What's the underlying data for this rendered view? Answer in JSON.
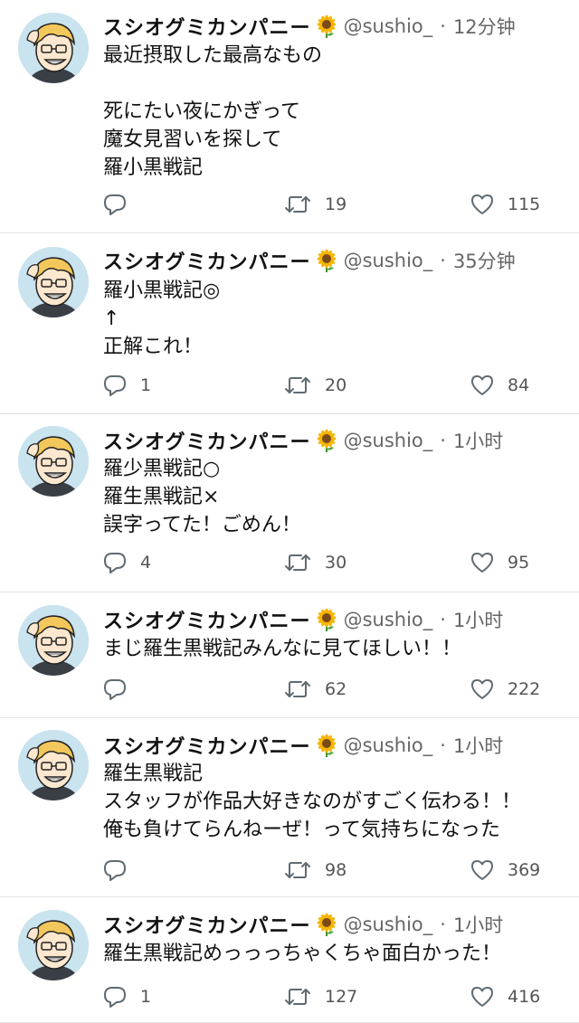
{
  "colors": {
    "text": "#111111",
    "muted": "#666666",
    "icon": "#5f6b73",
    "divider": "#e3e3e3",
    "avatar_bg": "#c9e3ef",
    "hair": "#f2c75b"
  },
  "tweets": [
    {
      "name": "スシオグミカンパニー",
      "emoji_icon": "sunflower-icon",
      "handle": "@sushio_",
      "dot": "·",
      "time": "12分钟",
      "lines": [
        "最近摂取した最高なもの",
        "",
        "死にたい夜にかぎって",
        "魔女見習いを探して",
        "羅小黒戦記"
      ],
      "replies": "",
      "retweets": "19",
      "likes": "115"
    },
    {
      "name": "スシオグミカンパニー",
      "emoji_icon": "sunflower-icon",
      "handle": "@sushio_",
      "dot": "·",
      "time": "35分钟",
      "lines": [
        "羅小黒戦記◎",
        "↑",
        "正解これ！"
      ],
      "replies": "1",
      "retweets": "20",
      "likes": "84"
    },
    {
      "name": "スシオグミカンパニー",
      "emoji_icon": "sunflower-icon",
      "handle": "@sushio_",
      "dot": "·",
      "time": "1小时",
      "lines": [
        "羅少黒戦記○",
        "羅生黒戦記×",
        "誤字ってた！ごめん！"
      ],
      "replies": "4",
      "retweets": "30",
      "likes": "95"
    },
    {
      "name": "スシオグミカンパニー",
      "emoji_icon": "sunflower-icon",
      "handle": "@sushio_",
      "dot": "·",
      "time": "1小时",
      "lines": [
        "まじ羅生黒戦記みんなに見てほしい！！"
      ],
      "replies": "",
      "retweets": "62",
      "likes": "222"
    },
    {
      "name": "スシオグミカンパニー",
      "emoji_icon": "sunflower-icon",
      "handle": "@sushio_",
      "dot": "·",
      "time": "1小时",
      "lines": [
        "羅生黒戦記",
        "スタッフが作品大好きなのがすごく伝わる！！",
        "俺も負けてらんねーぜ！って気持ちになった"
      ],
      "replies": "",
      "retweets": "98",
      "likes": "369"
    },
    {
      "name": "スシオグミカンパニー",
      "emoji_icon": "sunflower-icon",
      "handle": "@sushio_",
      "dot": "·",
      "time": "1小时",
      "lines": [
        "羅生黒戦記めっっっちゃくちゃ面白かった！"
      ],
      "replies": "1",
      "retweets": "127",
      "likes": "416"
    }
  ]
}
